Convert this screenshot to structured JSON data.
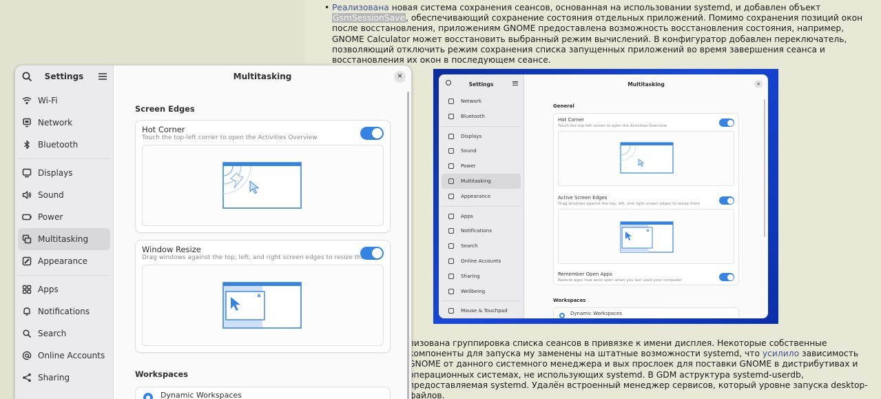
{
  "article": {
    "p1_link": "Реализована",
    "p1_a": " новая система сохранения сеансов, основанная на использовании systemd, и добавлен объект ",
    "p1_hl": "GsmSessionSave",
    "p1_b": ", обеспечивающий сохранение состояния отдельных приложений. Помимо сохранения позиций окон после восстановления, приложениям GNOME предоставлена возможность восстановления состояния, например, GNOME Calculator может восстановить выбранный режим вычислений. В конфигуратор добавлен переключатель, позволяющий отключить режим сохранения списка запущенных приложений во время завершения сеанса и восстановления их окон в последующем сеансе.",
    "p2_a": "лизована группировка списка сеансов в привязке к имени дисплея. Некоторые собственные компоненты для запуска му заменены на штатные возможности systemd, что ",
    "p2_link": "усилило",
    "p2_b": " зависимость GNOME от данного системного менеджера и вых прослоек для поставки GNOME в дистрибутивах и операционных системах, не использующих systemd. В GDM аструктура systemd-userdb, предоставляемая systemd. Удалён встроенный менеджер сервисов, который уровне запуска desktop-файлов."
  },
  "embedded": {
    "sidebar_title": "Settings",
    "title": "Multitasking",
    "close": "×",
    "items": [
      "Network",
      "Bluetooth",
      "Displays",
      "Sound",
      "Power",
      "Multitasking",
      "Appearance",
      "Apps",
      "Notifications",
      "Search",
      "Online Accounts",
      "Sharing",
      "Wellbeing",
      "Mouse & Touchpad"
    ],
    "section_general": "General",
    "hot_corner": "Hot Corner",
    "hot_corner_sub": "Touch the top-left corner to open the Activities Overview",
    "active_edges": "Active Screen Edges",
    "active_edges_sub": "Drag windows against the top, left, and right screen edges to resize them",
    "remember": "Remember Open Apps",
    "remember_sub": "Restore apps that were open when you last used your computer",
    "section_workspaces": "Workspaces",
    "dynamic": "Dynamic Workspaces"
  },
  "settings": {
    "sidebar_title": "Settings",
    "title": "Multitasking",
    "close": "×",
    "nav": {
      "wifi": "Wi-Fi",
      "network": "Network",
      "bluetooth": "Bluetooth",
      "displays": "Displays",
      "sound": "Sound",
      "power": "Power",
      "multitasking": "Multitasking",
      "appearance": "Appearance",
      "apps": "Apps",
      "notifications": "Notifications",
      "search": "Search",
      "online_accounts": "Online Accounts",
      "sharing": "Sharing"
    },
    "screen_edges": "Screen Edges",
    "hot_corner": "Hot Corner",
    "hot_corner_sub": "Touch the top-left corner to open the Activities Overview",
    "window_resize": "Window Resize",
    "window_resize_sub": "Drag windows against the top, left, and right screen edges to resize them",
    "workspaces": "Workspaces",
    "dynamic": "Dynamic Workspaces"
  },
  "colors": {
    "accent": "#3584e4",
    "page_bg": "#e2e3d0",
    "link": "#3e4f93"
  }
}
